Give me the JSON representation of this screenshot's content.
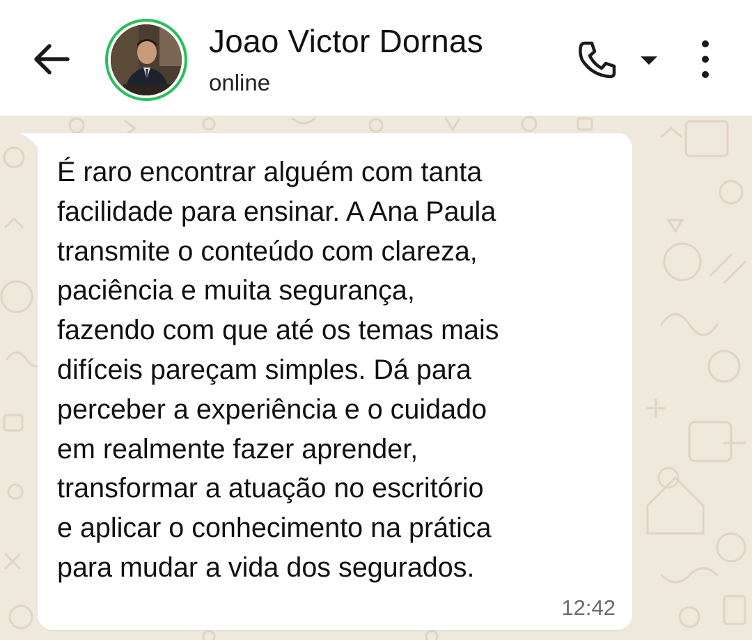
{
  "header": {
    "contact_name": "Joao Victor Dornas",
    "status": "online",
    "icons": [
      "back-arrow-icon",
      "avatar",
      "phone-icon",
      "caret-down-icon",
      "more-vert-icon"
    ],
    "ring_color": "#25c05a"
  },
  "message": {
    "lines": [
      "É raro encontrar alguém com tanta",
      "facilidade para ensinar. A Ana Paula",
      "transmite o conteúdo com clareza,",
      "paciência e muita segurança,",
      "fazendo com que até os temas mais",
      "difíceis pareçam simples. Dá para",
      "perceber a experiência e o cuidado",
      "em realmente fazer aprender,",
      "transformar a atuação no escritório",
      "e aplicar o conhecimento na prática",
      "para mudar a vida dos segurados."
    ],
    "time": "12:42"
  },
  "colors": {
    "chat_background": "#efe8dc",
    "bubble": "#ffffff"
  }
}
